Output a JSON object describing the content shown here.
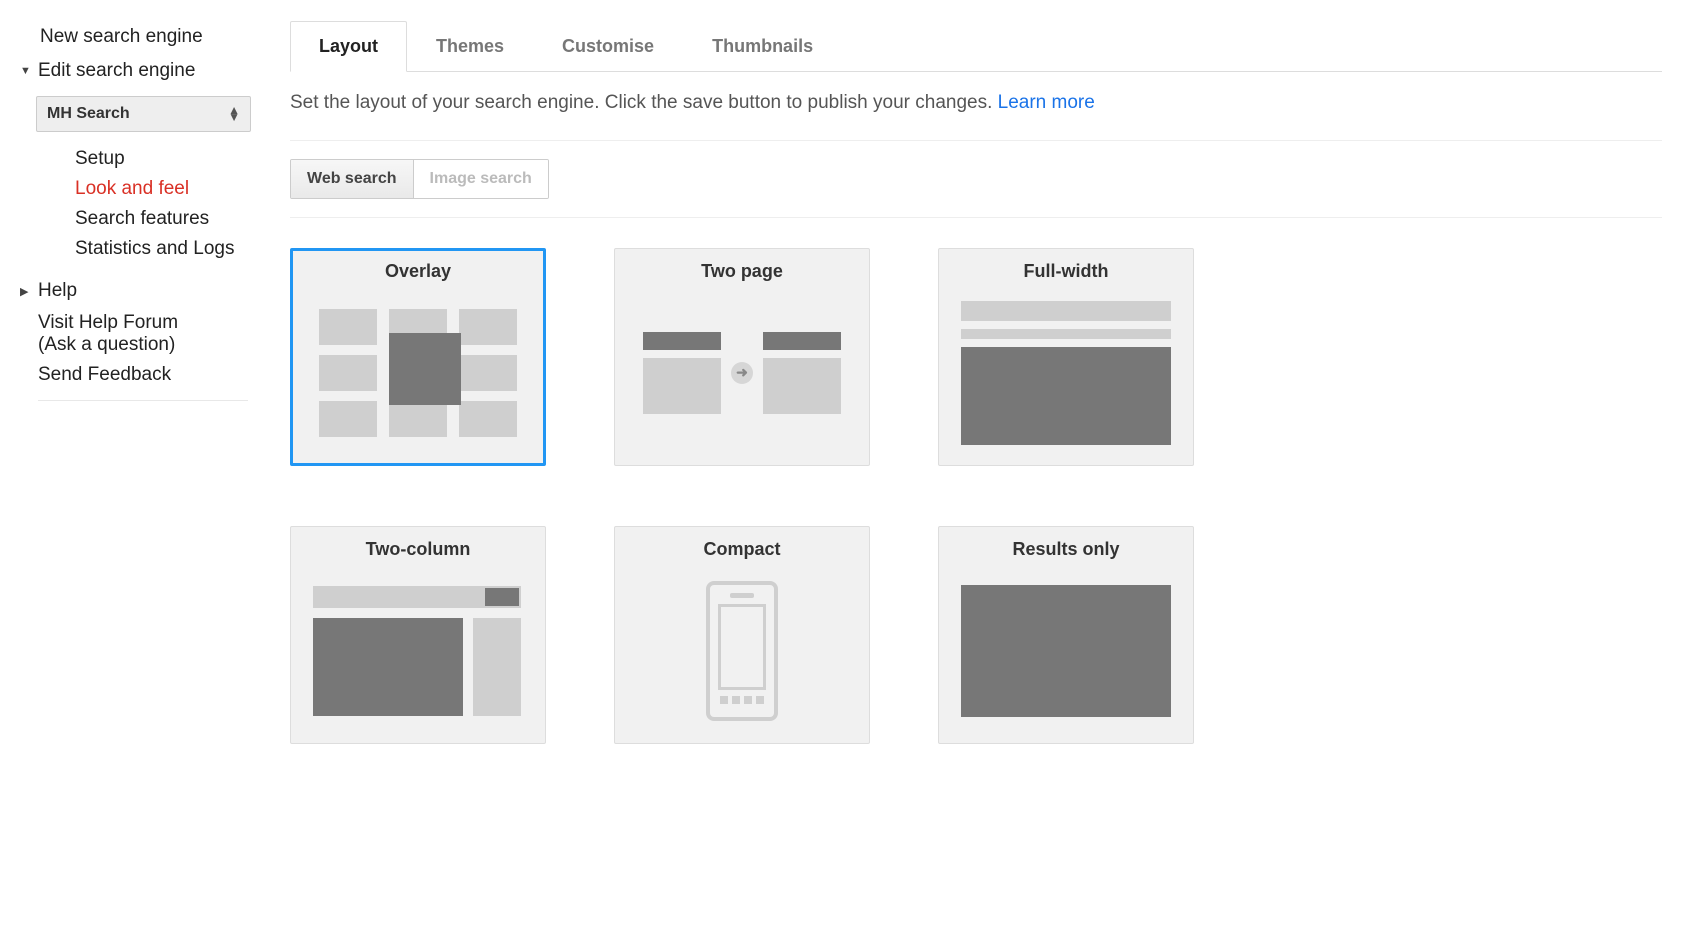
{
  "sidebar": {
    "new_engine": "New search engine",
    "edit_engine": "Edit search engine",
    "selected_engine": "MH Search",
    "subnav": [
      "Setup",
      "Look and feel",
      "Search features",
      "Statistics and Logs"
    ],
    "active_subnav": 1,
    "help": "Help",
    "visit_forum": "Visit Help Forum",
    "ask_question": "(Ask a question)",
    "send_feedback": "Send Feedback"
  },
  "tabs": {
    "items": [
      "Layout",
      "Themes",
      "Customise",
      "Thumbnails"
    ],
    "active": 0
  },
  "description": {
    "text": "Set the layout of your search engine. Click the save button to publish your changes. ",
    "learn_more": "Learn more"
  },
  "search_type": {
    "web": "Web search",
    "image": "Image search",
    "active": "web"
  },
  "layouts": {
    "items": [
      "Overlay",
      "Two page",
      "Full-width",
      "Two-column",
      "Compact",
      "Results only"
    ],
    "selected": 0
  }
}
